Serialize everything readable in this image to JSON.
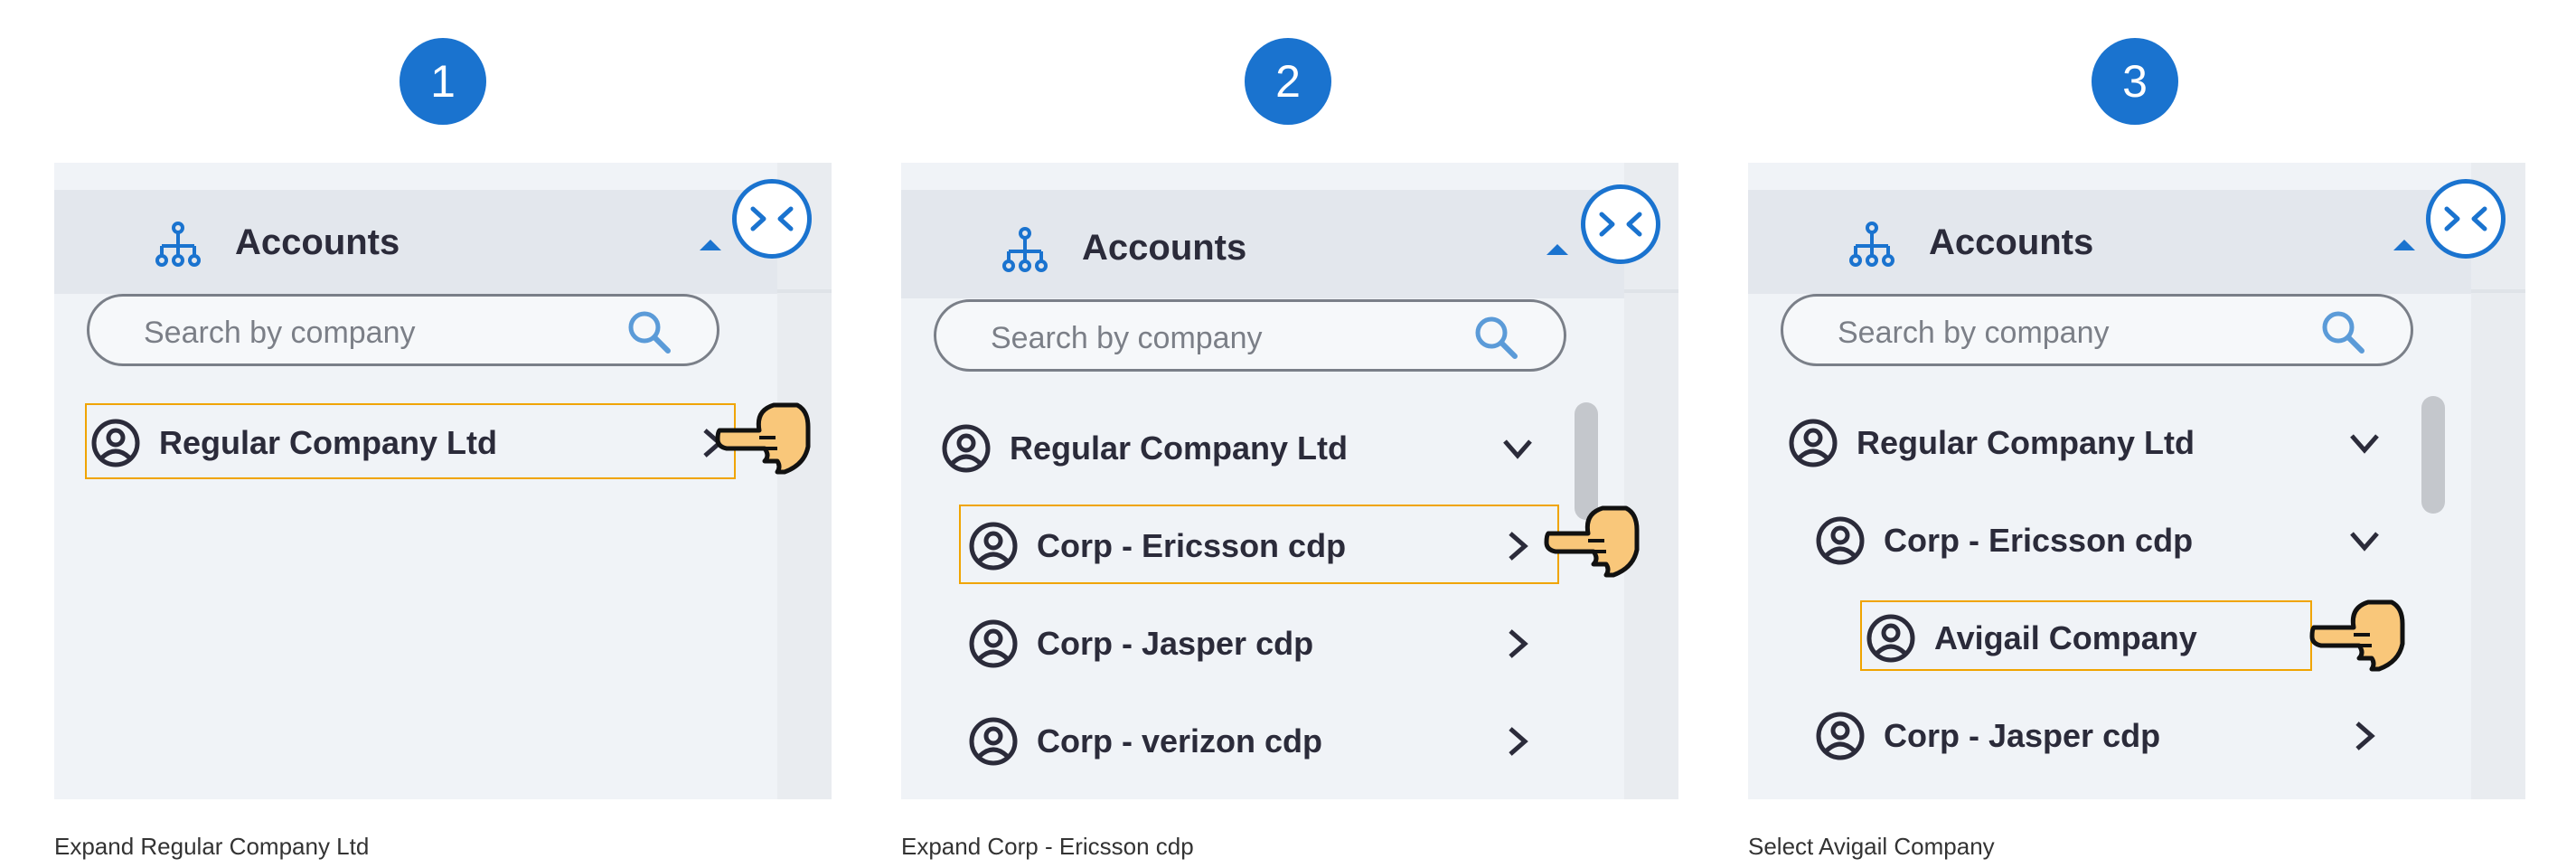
{
  "steps": [
    {
      "number": "1",
      "header": {
        "title": "Accounts"
      },
      "search": {
        "placeholder": "Search by company"
      },
      "tree": [
        {
          "label": "Regular Company Ltd",
          "chevron": "chevron-right",
          "highlighted": true
        }
      ],
      "caption": "Expand Regular Company Ltd"
    },
    {
      "number": "2",
      "header": {
        "title": "Accounts"
      },
      "search": {
        "placeholder": "Search by company"
      },
      "tree": [
        {
          "label": "Regular Company Ltd",
          "chevron": "chevron-down",
          "highlighted": false
        },
        {
          "label": "Corp - Ericsson cdp",
          "chevron": "chevron-right",
          "highlighted": true
        },
        {
          "label": "Corp - Jasper cdp",
          "chevron": "chevron-right",
          "highlighted": false
        },
        {
          "label": "Corp - verizon cdp",
          "chevron": "chevron-right",
          "highlighted": false
        }
      ],
      "caption": "Expand Corp - Ericsson cdp"
    },
    {
      "number": "3",
      "header": {
        "title": "Accounts"
      },
      "search": {
        "placeholder": "Search by company"
      },
      "tree": [
        {
          "label": "Regular Company Ltd",
          "chevron": "chevron-down",
          "highlighted": false
        },
        {
          "label": "Corp - Ericsson cdp",
          "chevron": "chevron-down",
          "highlighted": false
        },
        {
          "label": "Avigail Company",
          "chevron": "",
          "highlighted": true
        },
        {
          "label": "Corp - Jasper cdp",
          "chevron": "chevron-right",
          "highlighted": false
        }
      ],
      "caption": "Select Avigail Company"
    }
  ],
  "icons": {
    "accounts": "hierarchy-icon",
    "collapse": "collapse-arrows-icon",
    "search": "search-icon",
    "account": "person-circle-icon",
    "pointer": "pointing-hand-icon"
  },
  "colors": {
    "accent": "#1a73cf",
    "highlight": "#f0a400",
    "hand": "#f9c77a"
  }
}
